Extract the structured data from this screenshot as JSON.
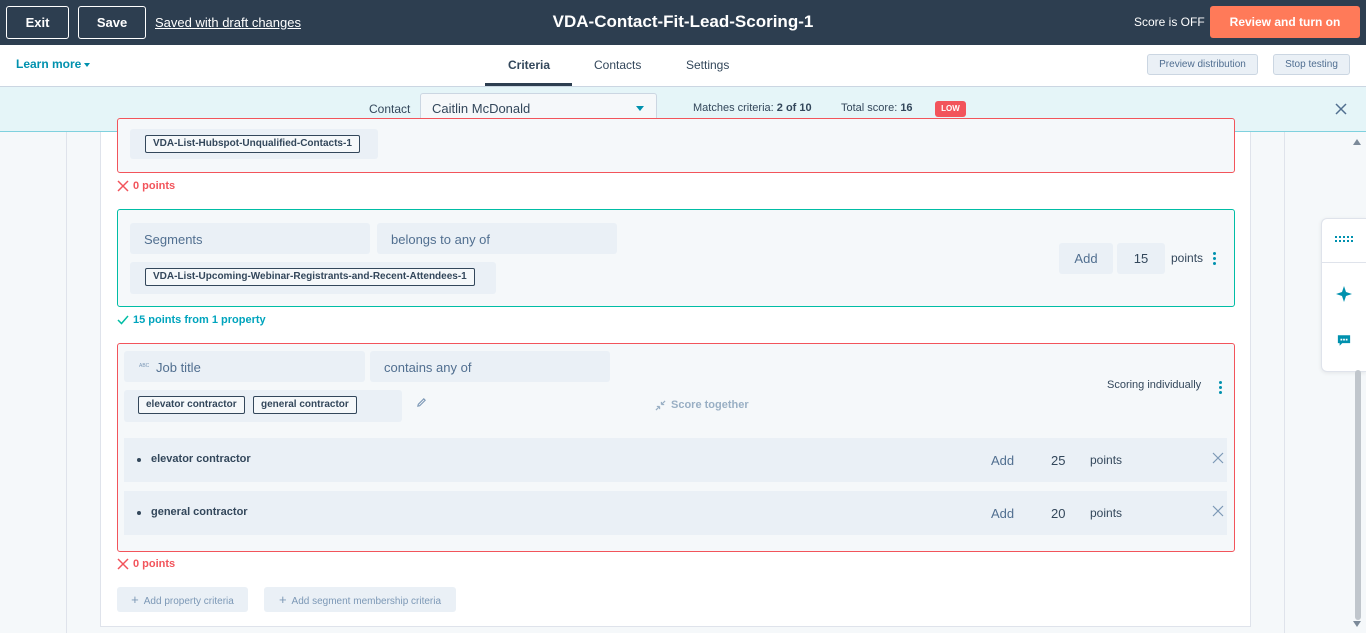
{
  "topbar": {
    "exit_label": "Exit",
    "save_label": "Save",
    "saved_status": "Saved with draft changes",
    "title": "VDA-Contact-Fit-Lead-Scoring-1",
    "score_status": "Score is OFF",
    "review_label": "Review and turn on"
  },
  "nav": {
    "learn_more": "Learn more",
    "tabs": [
      {
        "label": "Criteria",
        "active": true
      },
      {
        "label": "Contacts",
        "active": false
      },
      {
        "label": "Settings",
        "active": false
      }
    ],
    "preview_label": "Preview distribution",
    "stop_label": "Stop testing"
  },
  "testbar": {
    "contact_label": "Contact",
    "contact_value": "Caitlin McDonald",
    "matches_label": "Matches criteria:",
    "matches_value": "2 of 10",
    "total_label": "Total score:",
    "total_value": "16",
    "badge": "LOW"
  },
  "groups": {
    "group1": {
      "tag": "VDA-List-Hubspot-Unqualified-Contacts-1",
      "result": "0 points"
    },
    "group2": {
      "property": "Segments",
      "operator": "belongs to any of",
      "tag": "VDA-List-Upcoming-Webinar-Registrants-and-Recent-Attendees-1",
      "add_label": "Add",
      "points": "15",
      "points_label": "points",
      "result": "15 points from 1 property"
    },
    "group3": {
      "property_icon": "ABC",
      "property": "Job title",
      "operator": "contains any of",
      "tags": [
        "elevator contractor",
        "general contractor"
      ],
      "score_together": "Score together",
      "scoring_mode": "Scoring individually",
      "rows": [
        {
          "name": "elevator contractor",
          "add_label": "Add",
          "points": "25",
          "points_label": "points"
        },
        {
          "name": "general contractor",
          "add_label": "Add",
          "points": "20",
          "points_label": "points"
        }
      ],
      "result": "0 points"
    }
  },
  "actions": {
    "add_property": "Add property criteria",
    "add_segment": "Add segment membership criteria"
  },
  "colors": {
    "topbar": "#2d3e50",
    "accent_orange": "#ff7a59",
    "accent_teal": "#00bda5",
    "error_red": "#f2545b",
    "link_blue": "#0091ae"
  }
}
